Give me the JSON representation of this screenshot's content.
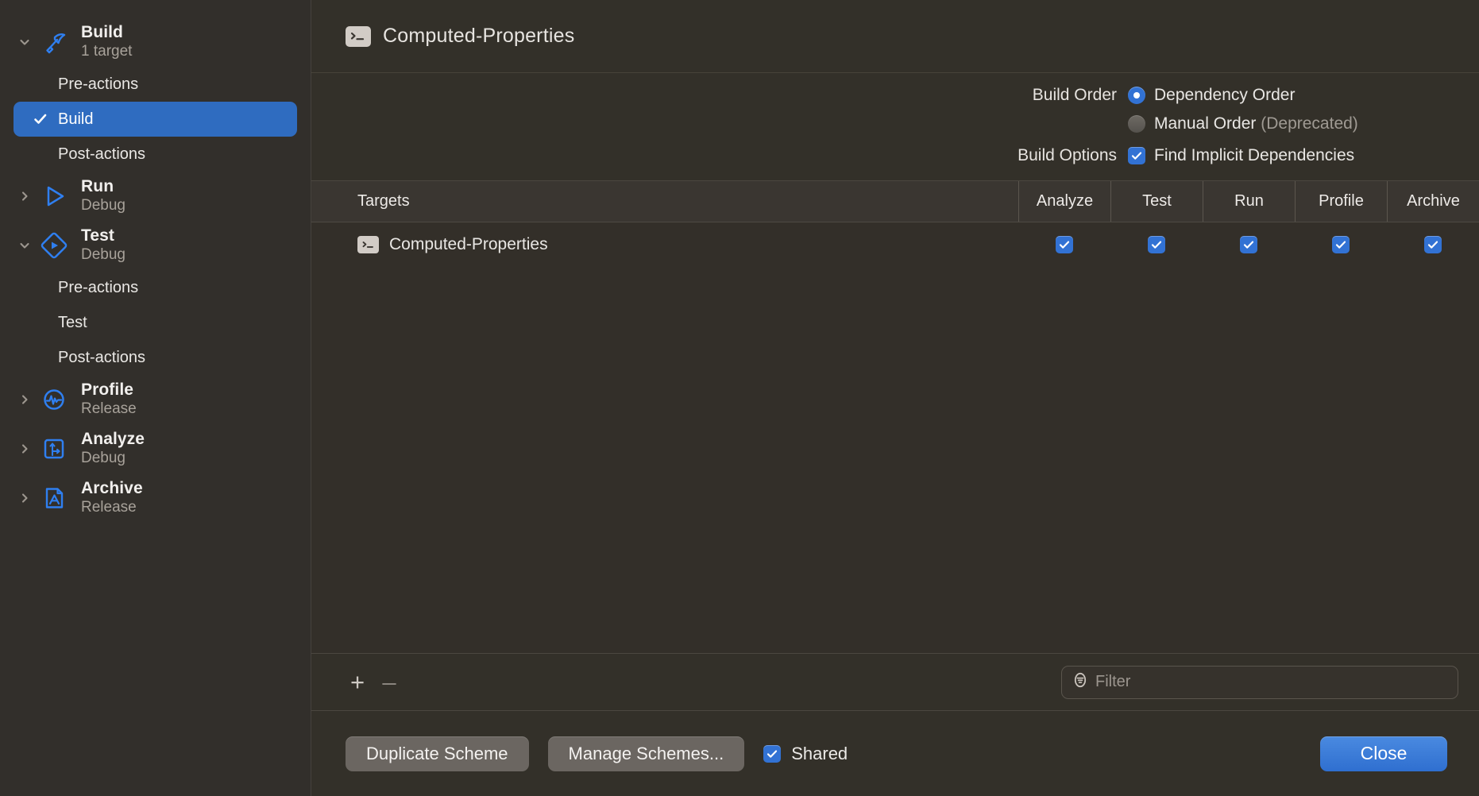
{
  "sidebar": {
    "groups": [
      {
        "title": "Build",
        "subtitle": "1 target",
        "icon": "hammer-icon",
        "expanded": true,
        "disclosure": "chevron-down-icon",
        "children": [
          {
            "label": "Pre-actions",
            "selected": false
          },
          {
            "label": "Build",
            "selected": true
          },
          {
            "label": "Post-actions",
            "selected": false
          }
        ]
      },
      {
        "title": "Run",
        "subtitle": "Debug",
        "icon": "play-triangle-icon",
        "expanded": false,
        "disclosure": "chevron-right-icon",
        "children": []
      },
      {
        "title": "Test",
        "subtitle": "Debug",
        "icon": "diamond-play-icon",
        "expanded": true,
        "disclosure": "chevron-down-icon",
        "children": [
          {
            "label": "Pre-actions",
            "selected": false
          },
          {
            "label": "Test",
            "selected": false
          },
          {
            "label": "Post-actions",
            "selected": false
          }
        ]
      },
      {
        "title": "Profile",
        "subtitle": "Release",
        "icon": "waveform-circle-icon",
        "expanded": false,
        "disclosure": "chevron-right-icon",
        "children": []
      },
      {
        "title": "Analyze",
        "subtitle": "Debug",
        "icon": "branch-square-icon",
        "expanded": false,
        "disclosure": "chevron-right-icon",
        "children": []
      },
      {
        "title": "Archive",
        "subtitle": "Release",
        "icon": "archive-document-icon",
        "expanded": false,
        "disclosure": "chevron-right-icon",
        "children": []
      }
    ],
    "selected_checkmark": "checkmark-icon"
  },
  "header": {
    "title": "Computed-Properties",
    "icon": "terminal-prompt-icon"
  },
  "options": {
    "build_order_label": "Build Order",
    "build_order_options": [
      {
        "label": "Dependency Order",
        "suffix": "",
        "selected": true
      },
      {
        "label": "Manual Order",
        "suffix": "(Deprecated)",
        "selected": false
      }
    ],
    "build_options_label": "Build Options",
    "find_implicit_label": "Find Implicit Dependencies",
    "find_implicit_checked": true
  },
  "table": {
    "columns": [
      "Targets",
      "Analyze",
      "Test",
      "Run",
      "Profile",
      "Archive"
    ],
    "rows": [
      {
        "target": "Computed-Properties",
        "icon": "terminal-prompt-icon",
        "analyze": true,
        "test": true,
        "run": true,
        "profile": true,
        "archive": true
      }
    ]
  },
  "table_toolbar": {
    "add_label": "+",
    "remove_label": "–",
    "filter_placeholder": "Filter",
    "filter_value": "",
    "filter_icon": "filter-icon"
  },
  "footer": {
    "duplicate_scheme_label": "Duplicate Scheme",
    "manage_schemes_label": "Manage Schemes...",
    "shared_label": "Shared",
    "shared_checked": true,
    "close_label": "Close"
  },
  "colors": {
    "accent_blue": "#3272d4",
    "selection_blue": "#2f6cc0",
    "sidebar_bg": "#322f2b",
    "content_bg": "#333029",
    "table_header_bg": "#3a3631",
    "icon_blue": "#2f7ff0",
    "text_primary": "#e9e7e4",
    "text_secondary": "#a8a29a"
  }
}
